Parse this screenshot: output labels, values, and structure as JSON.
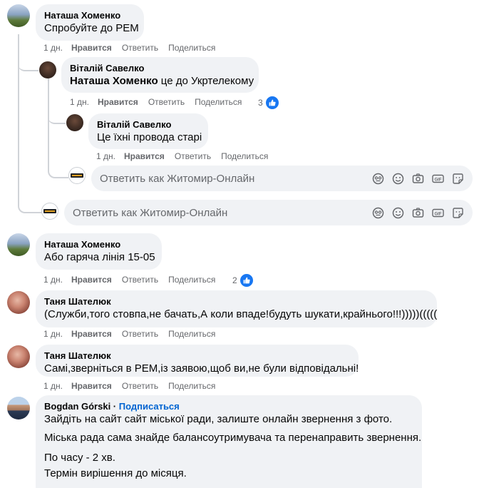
{
  "action_labels": {
    "like": "Нравится",
    "reply": "Ответить",
    "share": "Поделиться"
  },
  "reply_placeholder": "Ответить как Житомир-Онлайн",
  "comments": [
    {
      "author": "Наташа Хоменко",
      "text": "Спробуйте до РЕМ",
      "time": "1 дн."
    },
    {
      "author": "Віталій Савелко",
      "mention": "Наташа Хоменко",
      "text": " це до Укртелекому",
      "time": "1 дн.",
      "likes": "3"
    },
    {
      "author": "Віталій Савелко",
      "text": "Це їхні провода старі",
      "time": "1 дн."
    },
    {
      "author": "Наташа Хоменко",
      "text": "Або гаряча лінія 15-05",
      "time": "1 дн.",
      "likes": "2"
    },
    {
      "author": "Таня Шателюк",
      "text": "(Служби,того стовпа,не бачать,А коли впаде!будуть шукати,крайнього!!!)))))(((((",
      "time": "1 дн."
    },
    {
      "author": "Таня Шателюк",
      "text": "Самі,зверніться в РЕМ,із заявою,щоб ви,не були відповідальні!",
      "time": "1 дн."
    },
    {
      "author": "Bogdan Górski",
      "follow": "Подписаться",
      "lines": [
        "Зайдіть на сайт сайт міської ради, залиште онлайн звернення з фото.",
        "Міська рада сама знайде балансоутримувача та перенаправить звернення.",
        "По часу - 2 хв.",
        "Термін вирішення до місяця."
      ]
    }
  ],
  "reply_tools": [
    "sticker-face-icon",
    "emoji-icon",
    "camera-icon",
    "gif-icon",
    "sticker-icon"
  ],
  "colors": {
    "bubble": "#f0f2f5",
    "secondary_text": "#65676b",
    "link_blue": "#0064d1",
    "like_blue": "#1877f2",
    "thread_line": "#d0d3d8"
  }
}
